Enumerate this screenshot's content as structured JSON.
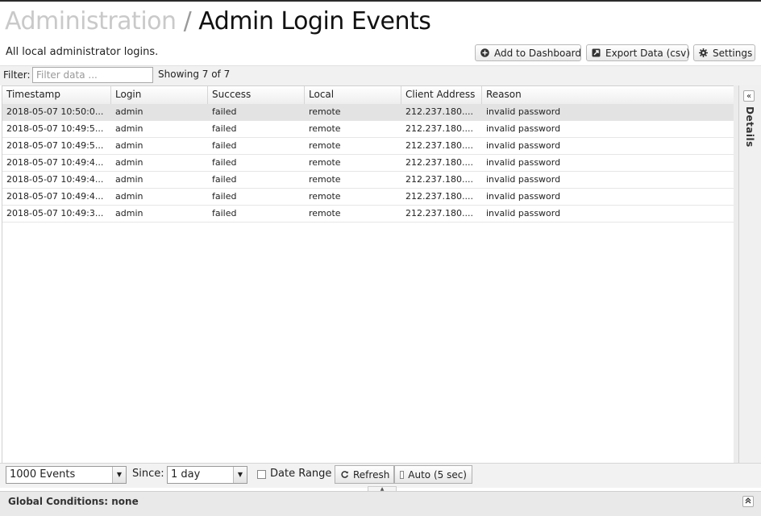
{
  "header": {
    "breadcrumb": "Administration",
    "separator": "/",
    "title": "Admin Login Events",
    "description": "All local administrator logins."
  },
  "toolbar": {
    "add_to_dashboard": "Add to Dashboard",
    "export_data": "Export Data (csv)",
    "settings": "Settings"
  },
  "filter": {
    "label": "Filter:",
    "placeholder": "Filter data ...",
    "value": "",
    "showing": "Showing 7 of 7"
  },
  "table": {
    "columns": [
      "Timestamp",
      "Login",
      "Success",
      "Local",
      "Client Address",
      "Reason"
    ],
    "rows": [
      [
        "2018-05-07 10:50:0...",
        "admin",
        "failed",
        "remote",
        "212.237.180....",
        "invalid password"
      ],
      [
        "2018-05-07 10:49:5...",
        "admin",
        "failed",
        "remote",
        "212.237.180....",
        "invalid password"
      ],
      [
        "2018-05-07 10:49:5...",
        "admin",
        "failed",
        "remote",
        "212.237.180....",
        "invalid password"
      ],
      [
        "2018-05-07 10:49:4...",
        "admin",
        "failed",
        "remote",
        "212.237.180....",
        "invalid password"
      ],
      [
        "2018-05-07 10:49:4...",
        "admin",
        "failed",
        "remote",
        "212.237.180....",
        "invalid password"
      ],
      [
        "2018-05-07 10:49:4...",
        "admin",
        "failed",
        "remote",
        "212.237.180....",
        "invalid password"
      ],
      [
        "2018-05-07 10:49:3...",
        "admin",
        "failed",
        "remote",
        "212.237.180....",
        "invalid password"
      ]
    ]
  },
  "details_panel": {
    "label": "Details",
    "toggle_icon": "double-chevron-left-icon"
  },
  "bottom": {
    "events_select": "1000 Events",
    "since_label": "Since:",
    "since_select": "1 day",
    "date_range": "Date Range",
    "refresh": "Refresh",
    "auto": "Auto (5 sec)"
  },
  "global": {
    "label": "Global Conditions: none",
    "toggle_icon": "double-chevron-up-icon"
  },
  "colors": {
    "breadcrumb": "#c9c9c9",
    "selected_row": "#e3e3e3",
    "toolbar_bg": "#f1f1f1"
  }
}
